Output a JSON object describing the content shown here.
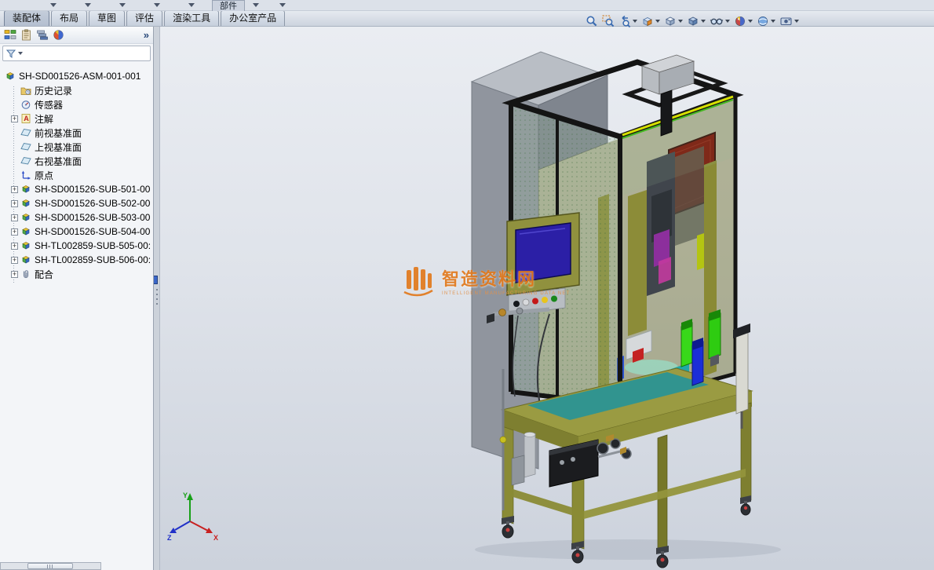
{
  "top_toolbar": {
    "cutoff_item_label": "部件"
  },
  "command_tabs": {
    "tabs": [
      {
        "label": "装配体",
        "active": true
      },
      {
        "label": "布局",
        "active": false
      },
      {
        "label": "草图",
        "active": false
      },
      {
        "label": "评估",
        "active": false
      },
      {
        "label": "渲染工具",
        "active": false
      },
      {
        "label": "办公室产品",
        "active": false
      }
    ]
  },
  "headsup": {
    "icons": [
      "zoom-to-fit",
      "zoom-area",
      "previous-view",
      "section-view",
      "view-orientation",
      "display-style",
      "hide-show-items",
      "edit-appearance",
      "apply-scene",
      "view-settings"
    ]
  },
  "feature_panel": {
    "tabs": [
      "featuremanager",
      "propertymanager",
      "configurationmanager",
      "displaymanager"
    ],
    "expand_chevron": "»",
    "tree": {
      "root_label": "SH-SD001526-ASM-001-001",
      "items": [
        {
          "label": "历史记录",
          "icon": "history-folder",
          "expandable": false
        },
        {
          "label": "传感器",
          "icon": "sensors",
          "expandable": false
        },
        {
          "label": "注解",
          "icon": "annotations",
          "expandable": true
        },
        {
          "label": "前视基准面",
          "icon": "plane",
          "expandable": false
        },
        {
          "label": "上视基准面",
          "icon": "plane",
          "expandable": false
        },
        {
          "label": "右视基准面",
          "icon": "plane",
          "expandable": false
        },
        {
          "label": "原点",
          "icon": "origin",
          "expandable": false
        },
        {
          "label": "SH-SD001526-SUB-501-00",
          "icon": "subassembly",
          "expandable": true
        },
        {
          "label": "SH-SD001526-SUB-502-00",
          "icon": "subassembly",
          "expandable": true
        },
        {
          "label": "SH-SD001526-SUB-503-00",
          "icon": "subassembly",
          "expandable": true
        },
        {
          "label": "SH-SD001526-SUB-504-00",
          "icon": "subassembly",
          "expandable": true
        },
        {
          "label": "SH-TL002859-SUB-505-00:",
          "icon": "subassembly",
          "expandable": true
        },
        {
          "label": "SH-TL002859-SUB-506-00:",
          "icon": "subassembly",
          "expandable": true
        },
        {
          "label": "配合",
          "icon": "mates",
          "expandable": true
        }
      ]
    }
  },
  "viewport": {
    "watermark": {
      "title": "智造资料网",
      "subtitle": "INTELLIGENT MANUFACTURING DATA NET",
      "accent_color": "#e2791c"
    },
    "triad": {
      "x_label": "X",
      "y_label": "Y",
      "z_label": "Z"
    }
  }
}
